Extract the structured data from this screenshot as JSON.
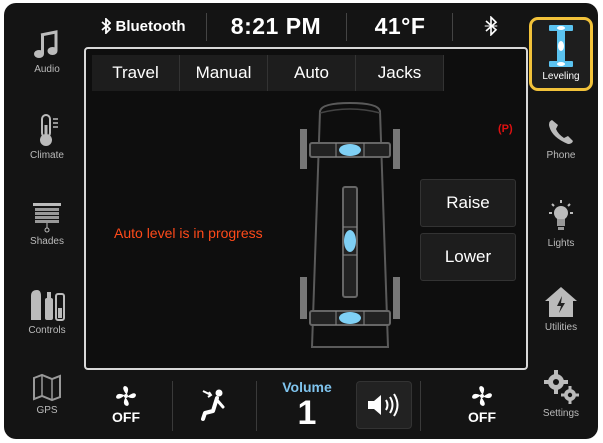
{
  "status_bar": {
    "bluetooth_label": "Bluetooth",
    "time": "8:21 PM",
    "temperature": "41°F",
    "icons": [
      "bluetooth-icon",
      "bluetooth-icon"
    ]
  },
  "left_nav": [
    {
      "label": "Audio",
      "icon": "music-note-icon"
    },
    {
      "label": "Climate",
      "icon": "thermometer-icon"
    },
    {
      "label": "Shades",
      "icon": "shades-icon"
    },
    {
      "label": "Controls",
      "icon": "controls-icon"
    },
    {
      "label": "GPS",
      "icon": "map-icon"
    }
  ],
  "right_nav": [
    {
      "label": "Leveling",
      "icon": "leveling-icon",
      "selected": true
    },
    {
      "label": "Phone",
      "icon": "phone-icon"
    },
    {
      "label": "Lights",
      "icon": "light-bulb-icon"
    },
    {
      "label": "Utilities",
      "icon": "house-power-icon"
    },
    {
      "label": "Settings",
      "icon": "gears-icon"
    }
  ],
  "tabs": [
    {
      "label": "Travel"
    },
    {
      "label": "Manual"
    },
    {
      "label": "Auto"
    },
    {
      "label": "Jacks"
    }
  ],
  "main": {
    "status_text": "Auto level is in progress",
    "raise_label": "Raise",
    "lower_label": "Lower",
    "parking_brake_icon": "parking-brake-icon"
  },
  "bottom_bar": {
    "fan_left_label": "OFF",
    "fan_right_label": "OFF",
    "volume_label": "Volume",
    "volume_value": "1",
    "icons": [
      "fan-icon",
      "seat-airflow-icon",
      "speaker-icon",
      "fan-icon"
    ]
  },
  "colors": {
    "accent_highlight": "#f2c23a",
    "status_text": "#ff4a1a",
    "volume_label": "#7fc4ee",
    "level_bubble": "#7fd0f5"
  }
}
